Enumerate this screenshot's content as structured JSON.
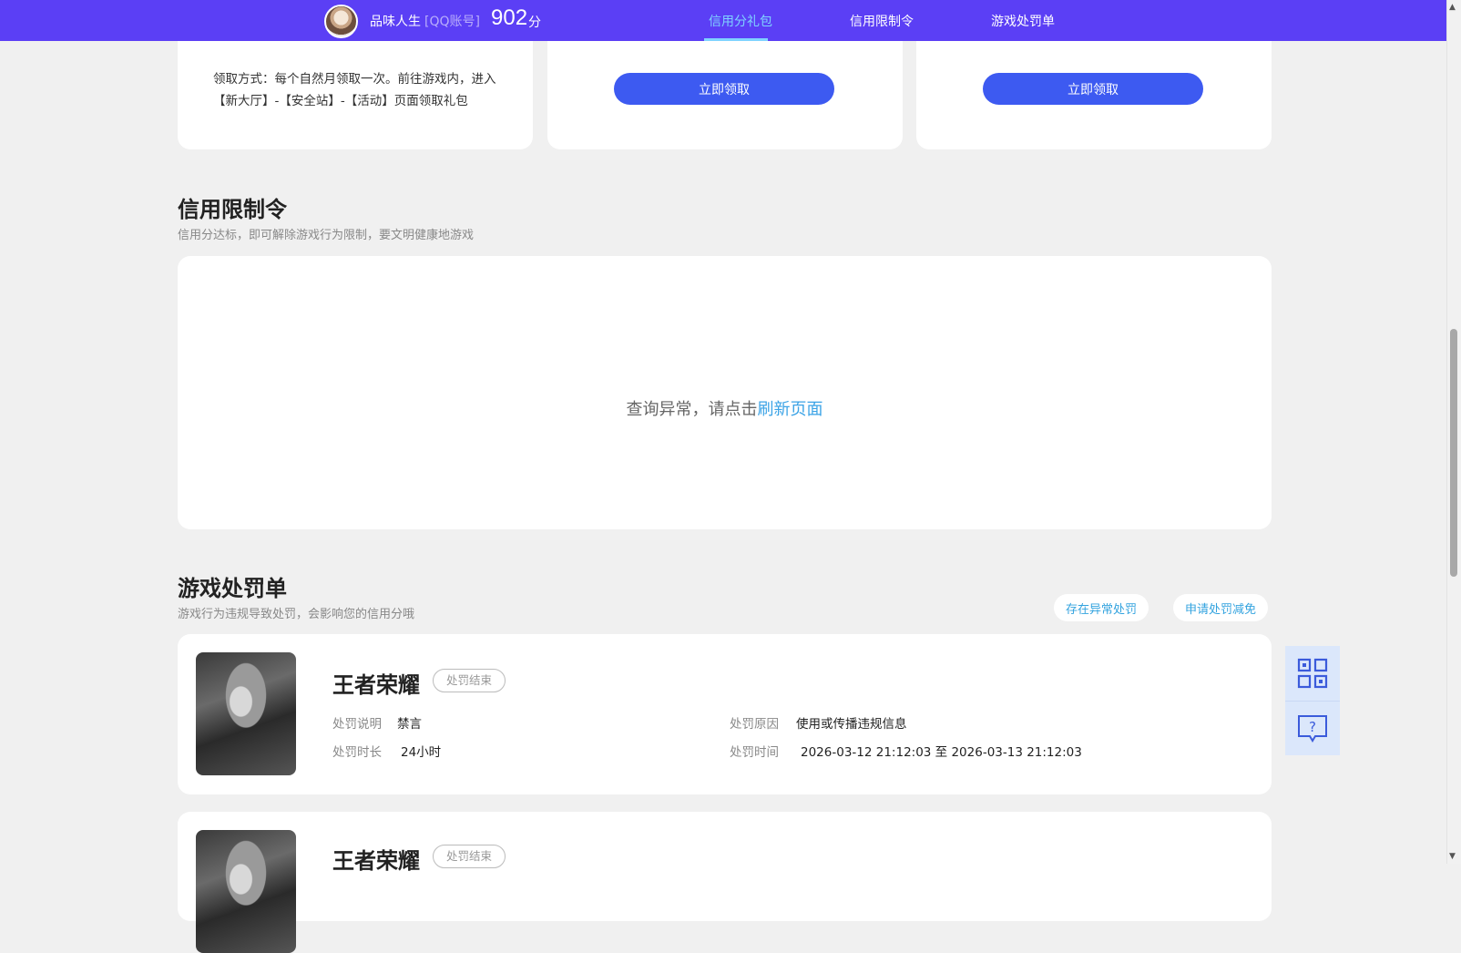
{
  "header": {
    "user_name": "品味人生",
    "account_type": "[QQ账号]",
    "score": "902",
    "score_unit": "分",
    "tabs": [
      {
        "label": "信用分礼包",
        "active": true
      },
      {
        "label": "信用限制令",
        "active": false
      },
      {
        "label": "游戏处罚单",
        "active": false
      }
    ]
  },
  "gifts": {
    "card1_desc": "领取方式：每个自然月领取一次。前往游戏内，进入【新大厅】-【安全站】-【活动】页面领取礼包",
    "claim_label": "立即领取"
  },
  "restriction": {
    "title": "信用限制令",
    "subtitle": "信用分达标，即可解除游戏行为限制，要文明健康地游戏",
    "error_text": "查询异常，请点击",
    "refresh_link": "刷新页面"
  },
  "penalties": {
    "title": "游戏处罚单",
    "subtitle": "游戏行为违规导致处罚，会影响您的信用分哦",
    "btn_abnormal": "存在异常处罚",
    "btn_appeal": "申请处罚减免",
    "items": [
      {
        "game": "王者荣耀",
        "status": "处罚结束",
        "desc_label": "处罚说明",
        "desc_value": "禁言",
        "duration_label": "处罚时长",
        "duration_value": "24小时",
        "reason_label": "处罚原因",
        "reason_value": "使用或传播违规信息",
        "time_label": "处罚时间",
        "time_value": "2026-03-12 21:12:03 至 2026-03-13 21:12:03"
      },
      {
        "game": "王者荣耀",
        "status": "处罚结束"
      }
    ]
  },
  "colors": {
    "header_bg": "#5b3ff5",
    "accent_button": "#3d5af1",
    "active_tab": "#7fd3ff",
    "link": "#3ba3e6"
  },
  "icons": {
    "qr": "qr-code-icon",
    "help": "help-chat-icon"
  }
}
